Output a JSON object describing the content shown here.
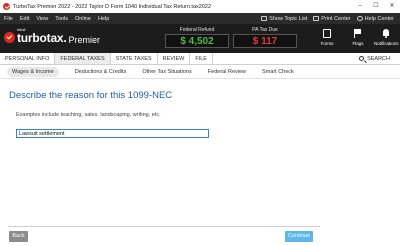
{
  "window": {
    "title": "TurboTax Premier 2022 - 2022 Taylor D Form 1040  Individual Tax Return.tax2022",
    "controls": [
      "–",
      "☐",
      "✕"
    ]
  },
  "menubar": {
    "items": [
      "File",
      "Edit",
      "View",
      "Tools",
      "Online",
      "Help"
    ],
    "show_topic_list": "Show Topic List",
    "print_center": "Print Center",
    "help_center": "Help Center"
  },
  "header": {
    "logo_small": "intuit",
    "logo_brand": "turbotax.",
    "logo_edition": "Premier",
    "federal_refund_label": "Federal Refund",
    "federal_refund_amount": "$ 4,502",
    "state_due_label": "PA Tax Due",
    "state_due_amount": "$ 117",
    "forms_label": "Forms",
    "flags_label": "Flags",
    "notifications_label": "Notifications",
    "colors": {
      "refund": "#54b948",
      "due": "#e23d3d",
      "brand_red": "#d52b1e"
    }
  },
  "nav": {
    "tabs": [
      "PERSONAL INFO",
      "FEDERAL TAXES",
      "STATE TAXES",
      "REVIEW",
      "FILE"
    ],
    "active_tab": "FEDERAL TAXES",
    "search_label": "SEARCH"
  },
  "subnav": {
    "items": [
      "Wages & Income",
      "Deductions & Credits",
      "Other Tax Situations",
      "Federal Review",
      "Smart Check"
    ],
    "active": "Wages & Income"
  },
  "main": {
    "heading": "Describe the reason for this 1099-NEC",
    "hint": "Examples include teaching, sales, landscaping, writing, etc.",
    "reason_value": "Lawsuit settlement"
  },
  "footer": {
    "back_label": "Back",
    "continue_label": "Continue",
    "colors": {
      "continue": "#5fb6e8",
      "back": "#8c8c8c"
    }
  }
}
